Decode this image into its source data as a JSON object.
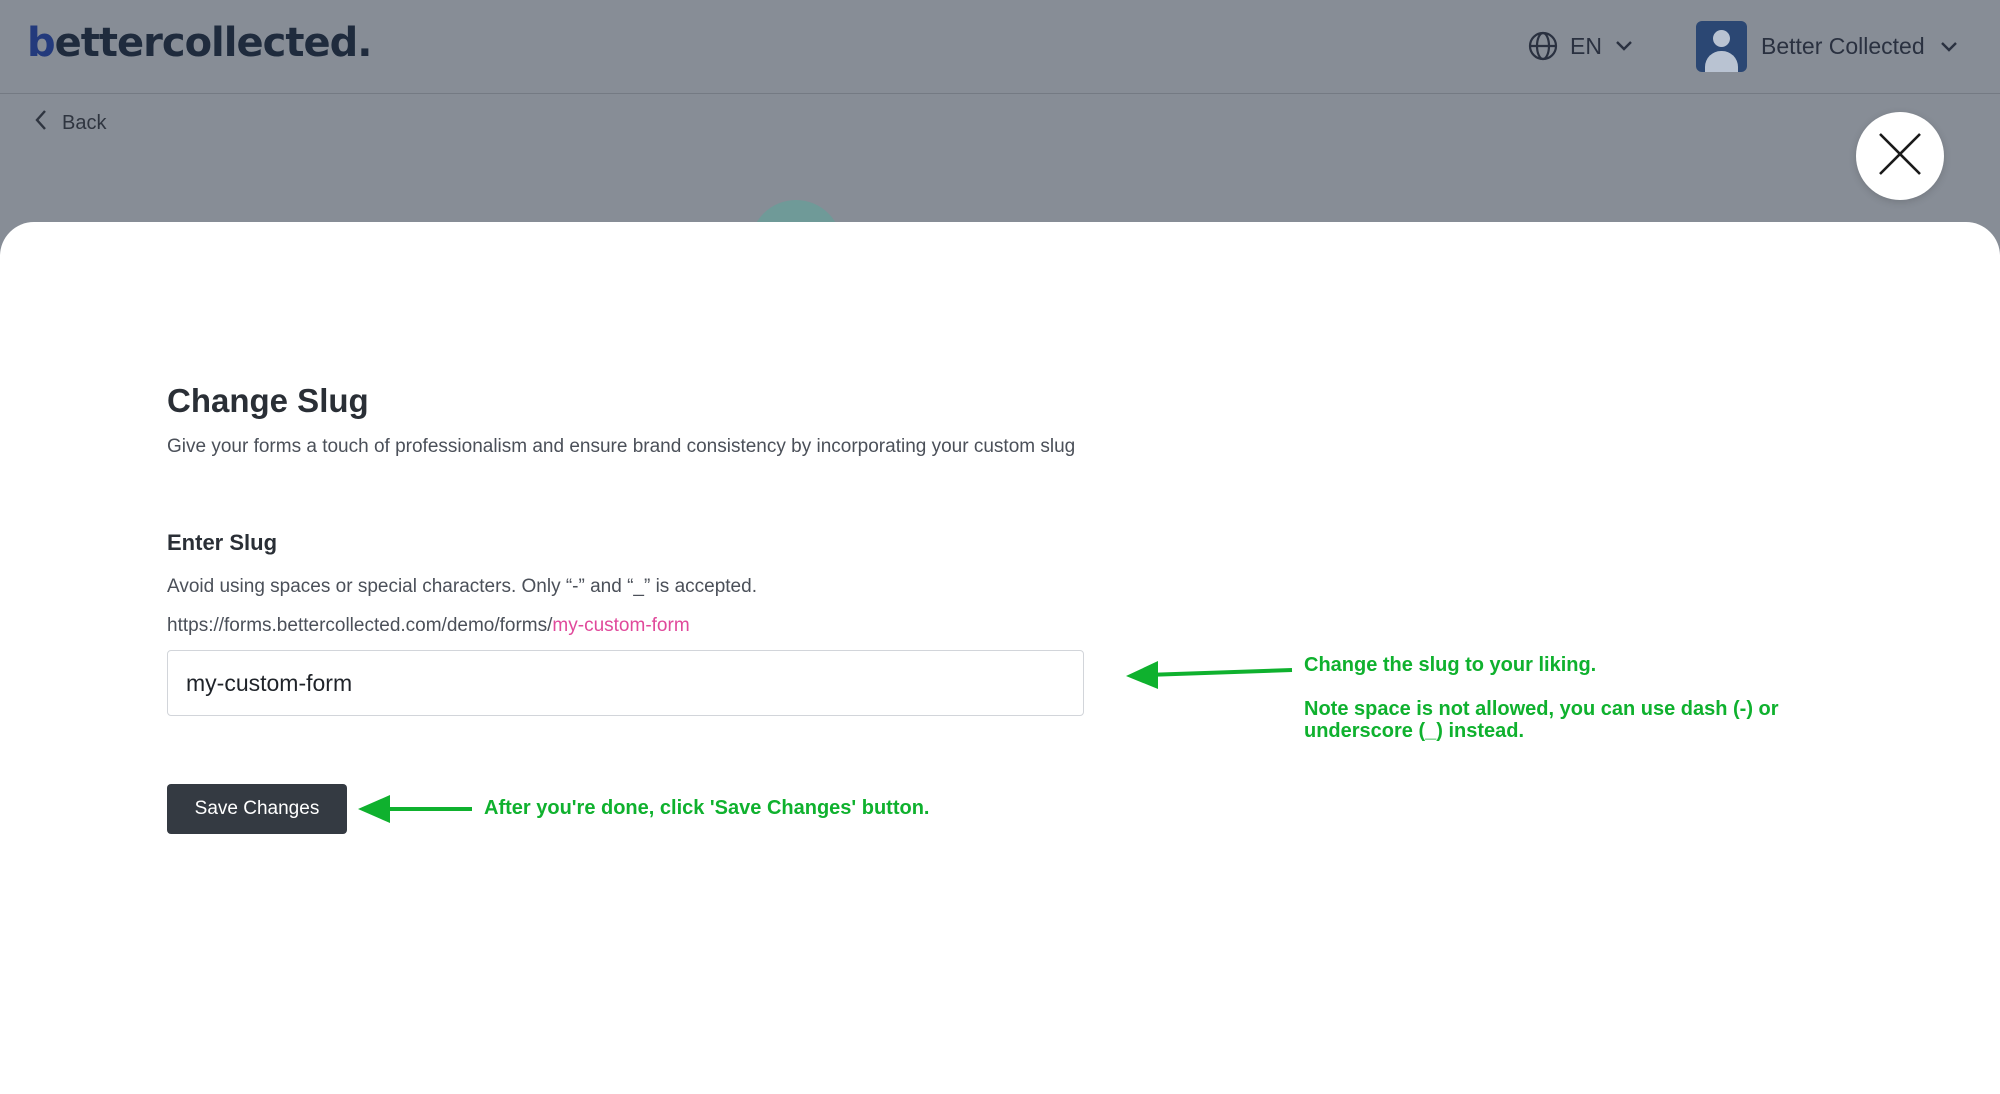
{
  "header": {
    "logo_b": "b",
    "logo_rest": "ettercollected.",
    "language": "EN",
    "user_name": "Better Collected"
  },
  "nav": {
    "back_label": "Back"
  },
  "modal": {
    "title": "Change Slug",
    "subtitle": "Give your forms a touch of professionalism and ensure brand consistency by incorporating your custom slug",
    "section_title": "Enter Slug",
    "hint": "Avoid using spaces or special characters. Only “-” and “_” is accepted.",
    "url_prefix": "https://forms.bettercollected.com/demo/forms/",
    "url_slug": "my-custom-form",
    "input_value": "my-custom-form",
    "save_label": "Save Changes"
  },
  "annotations": {
    "input_note_1": "Change the slug to your liking.",
    "input_note_2": "Note space is not allowed, you can use dash (-) or underscore (_) instead.",
    "save_note": "After you're done, click 'Save Changes' button."
  },
  "colors": {
    "overlay": "#878d96",
    "slug_highlight": "#e0499b",
    "annotation": "#0fb12e",
    "button_bg": "#343a42"
  },
  "icons": [
    "globe-icon",
    "chevron-down-icon",
    "avatar",
    "chevron-left-icon",
    "close-icon",
    "arrow-left-icon"
  ]
}
